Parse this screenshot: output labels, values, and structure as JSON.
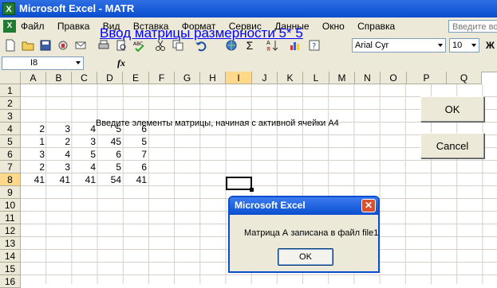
{
  "window": {
    "title": "Microsoft Excel - MATR"
  },
  "menu": {
    "items": [
      "Файл",
      "Правка",
      "Вид",
      "Вставка",
      "Формат",
      "Сервис",
      "Данные",
      "Окно",
      "Справка"
    ],
    "help_placeholder": "Введите во"
  },
  "toolbar": {
    "font_name": "Arial Cyr",
    "font_size": "10",
    "sum_symbol": "Σ",
    "bold_label": "Ж"
  },
  "formula_bar": {
    "name_box": "I8",
    "fx_label": "fx"
  },
  "columns": [
    "A",
    "B",
    "C",
    "D",
    "E",
    "F",
    "G",
    "H",
    "I",
    "J",
    "K",
    "L",
    "M",
    "N",
    "O",
    "P",
    "Q"
  ],
  "rows": [
    "1",
    "2",
    "3",
    "4",
    "5",
    "6",
    "7",
    "8",
    "9",
    "10",
    "11",
    "12",
    "13",
    "14",
    "15",
    "16"
  ],
  "active": {
    "column": "I",
    "row": "8"
  },
  "sheet": {
    "heading": "Ввод матрицы размерности     5* 5",
    "subheading": "Введите элементы матрицы, начиная с активной ячейки А4",
    "matrix": [
      [
        "2",
        "3",
        "4",
        "5",
        "6"
      ],
      [
        "1",
        "2",
        "3",
        "45",
        "5"
      ],
      [
        "3",
        "4",
        "5",
        "6",
        "7"
      ],
      [
        "2",
        "3",
        "4",
        "5",
        "6"
      ],
      [
        "41",
        "41",
        "41",
        "54",
        "41"
      ]
    ],
    "ok_button": "OK",
    "cancel_button": "Cancel"
  },
  "dialog": {
    "title": "Microsoft Excel",
    "message": "Матрица А записана в файл   file1",
    "ok_button": "OK",
    "close_symbol": "✕"
  }
}
